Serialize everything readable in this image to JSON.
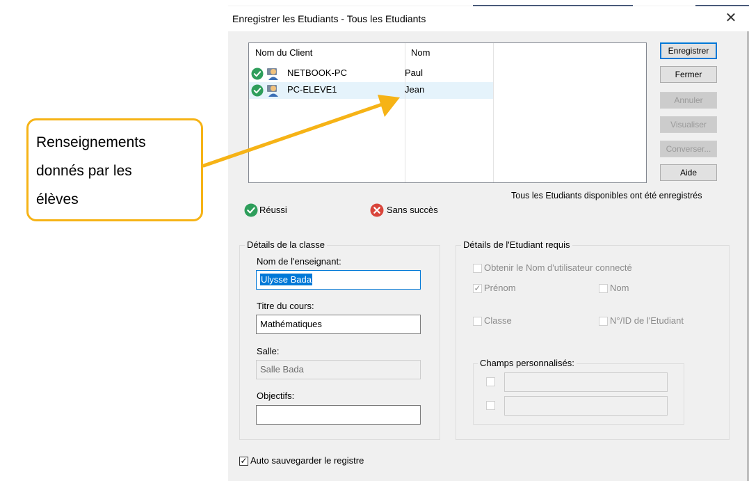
{
  "dialog": {
    "title": "Enregistrer les Etudiants - Tous les Etudiants",
    "close_glyph": "✕"
  },
  "list": {
    "headers": [
      "Nom du Client",
      "Nom"
    ],
    "rows": [
      {
        "client": "NETBOOK-PC",
        "name": "Paul",
        "status": "success",
        "selected": false
      },
      {
        "client": "PC-ELEVE1",
        "name": "Jean",
        "status": "success",
        "selected": true
      }
    ]
  },
  "buttons": {
    "register": "Enregistrer",
    "close": "Fermer",
    "cancel": "Annuler",
    "view": "Visualiser",
    "chat": "Converser...",
    "help": "Aide"
  },
  "status_message": "Tous les Etudiants disponibles ont été enregistrés",
  "legend": {
    "success": "Réussi",
    "failure": "Sans succès"
  },
  "class_details": {
    "group_label": "Détails de la classe",
    "teacher_label": "Nom de l'enseignant:",
    "teacher_value": "Ulysse Bada",
    "course_label": "Titre du cours:",
    "course_value": "Mathématiques",
    "room_label": "Salle:",
    "room_value": "Salle Bada",
    "objectives_label": "Objectifs:",
    "objectives_value": ""
  },
  "student_details": {
    "group_label": "Détails de l'Etudiant requis",
    "logged_user": {
      "label": "Obtenir le Nom d'utilisateur connecté",
      "checked": false
    },
    "first_name": {
      "label": "Prénom",
      "checked": true
    },
    "last_name": {
      "label": "Nom",
      "checked": false
    },
    "class": {
      "label": "Classe",
      "checked": false
    },
    "student_id": {
      "label": "N°/ID de l'Etudiant",
      "checked": false
    },
    "custom_fields_label": "Champs personnalisés:"
  },
  "autosave": {
    "label": "Auto sauvegarder le registre",
    "checked": true
  },
  "callout": {
    "lines": [
      "Renseignements",
      "donnés par les",
      "élèves"
    ]
  },
  "colors": {
    "success_green": "#2e9e5b",
    "failure_red": "#d9453b",
    "callout_orange": "#f6b316",
    "focus_blue": "#0078d7",
    "selection": "#e5f3fb"
  },
  "icons": {
    "success": "check-circle-icon",
    "failure": "x-circle-icon",
    "computer_user": "user-computer-icon",
    "close": "close-icon",
    "arrow": "arrow-icon"
  }
}
